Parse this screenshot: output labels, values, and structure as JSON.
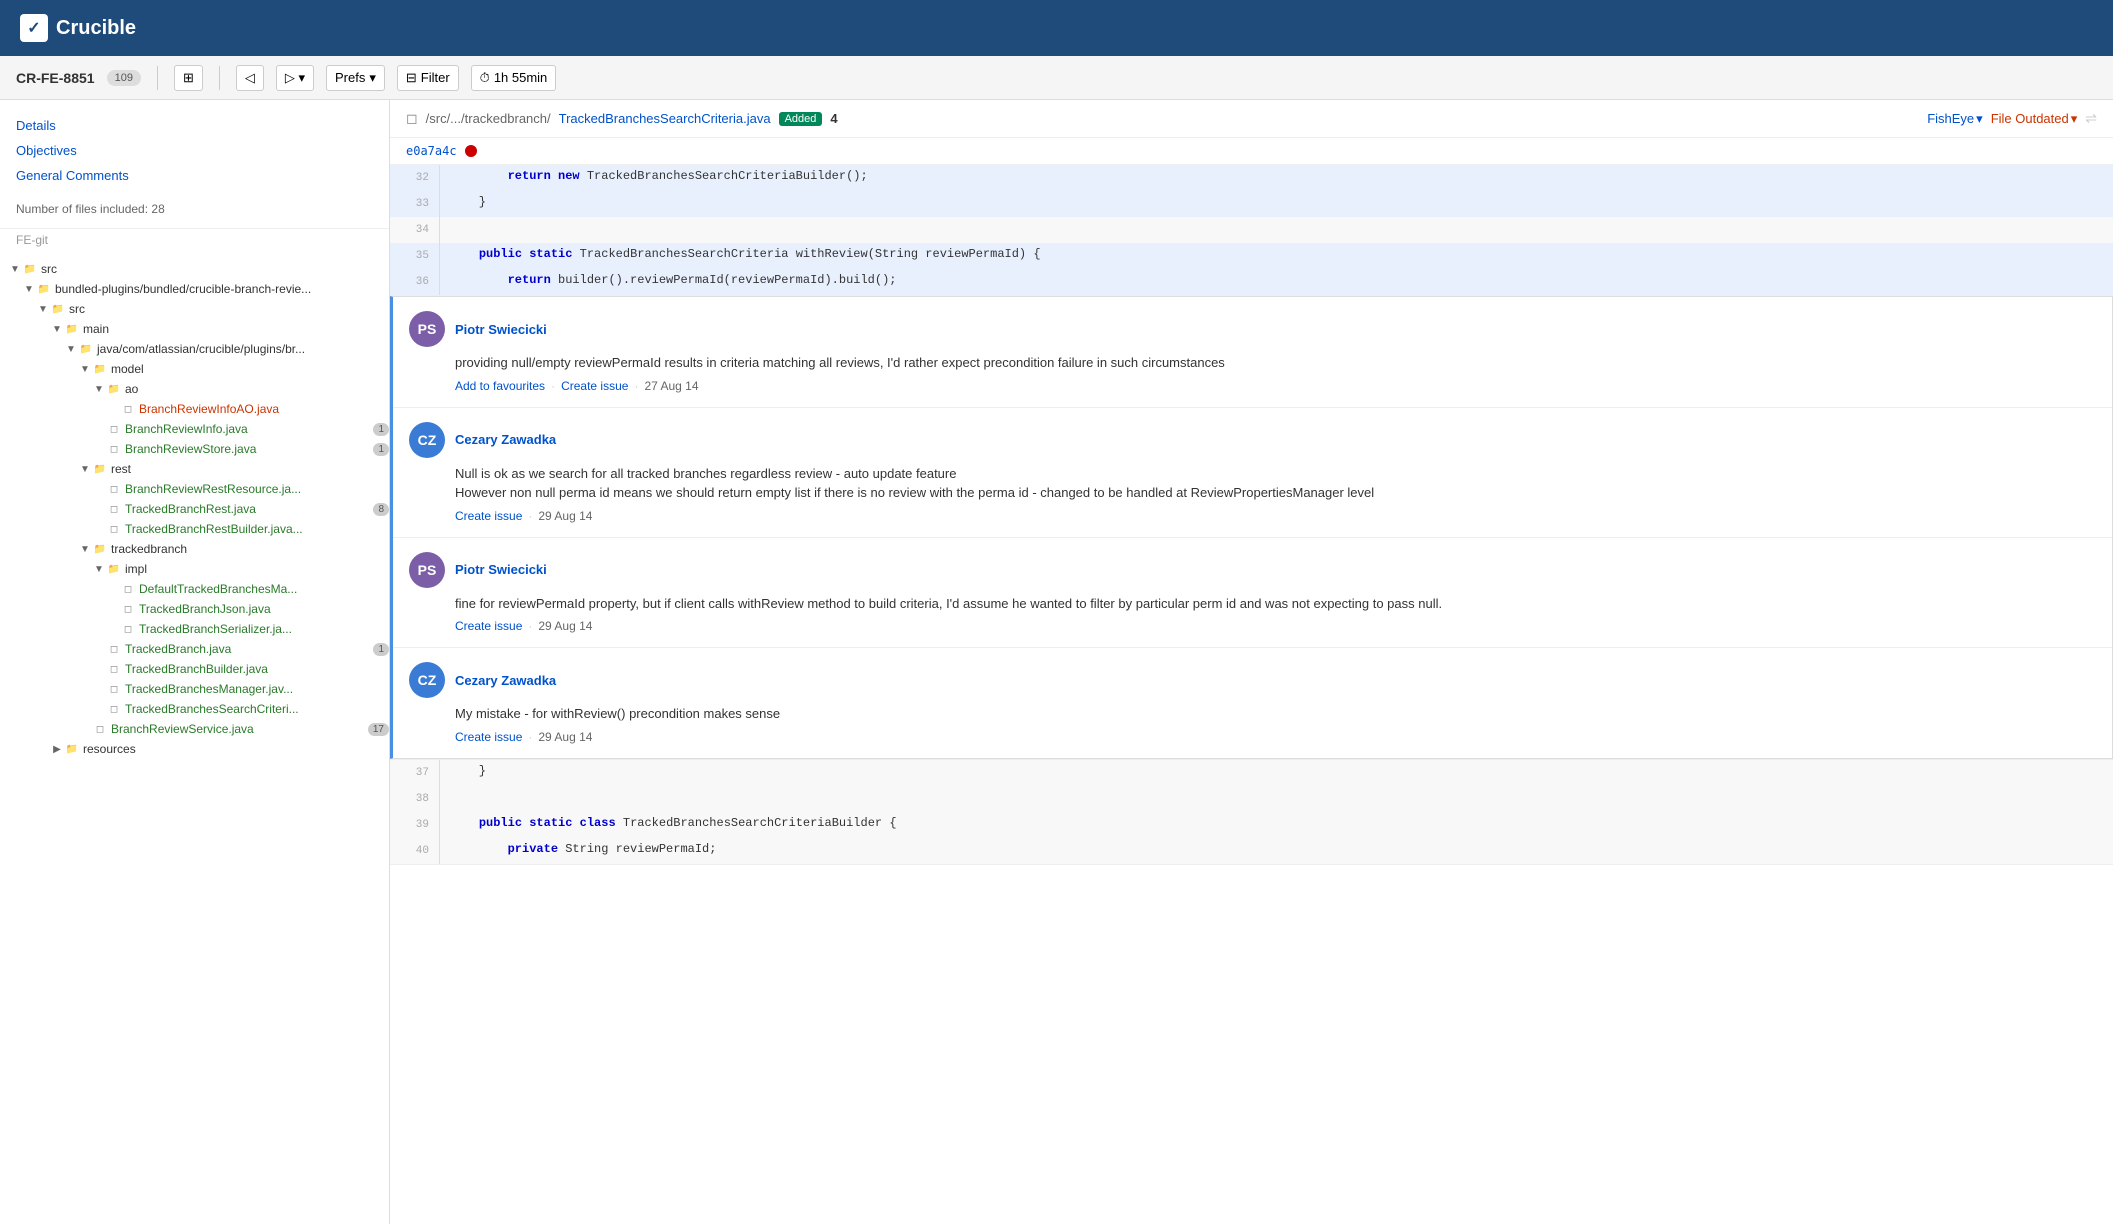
{
  "app": {
    "name": "Crucible",
    "logo_char": "✓"
  },
  "review": {
    "id": "CR-FE-8851",
    "comment_count": "109",
    "expand_icon": "⊞"
  },
  "toolbar": {
    "back_icon": "◁",
    "forward_icon": "▷",
    "dropdown_icon": "▾",
    "prefs_label": "Prefs",
    "filter_label": "Filter",
    "time_label": "1h 55min",
    "filter_icon": "⊟",
    "clock_icon": "⏱"
  },
  "sidebar": {
    "details_label": "Details",
    "objectives_label": "Objectives",
    "general_comments_label": "General Comments",
    "file_count_label": "Number of files included: 28",
    "repo_label": "FE-git"
  },
  "file_tree": {
    "items": [
      {
        "indent": 0,
        "type": "folder",
        "label": "src",
        "open": true
      },
      {
        "indent": 1,
        "type": "folder",
        "label": "bundled-plugins/bundled/crucible-branch-revie...",
        "open": true
      },
      {
        "indent": 2,
        "type": "folder",
        "label": "src",
        "open": true
      },
      {
        "indent": 3,
        "type": "folder",
        "label": "main",
        "open": true
      },
      {
        "indent": 4,
        "type": "folder",
        "label": "java/com/atlassian/crucible/plugins/br...",
        "open": true
      },
      {
        "indent": 5,
        "type": "folder",
        "label": "model",
        "open": true
      },
      {
        "indent": 6,
        "type": "folder",
        "label": "ao",
        "open": true
      },
      {
        "indent": 7,
        "type": "file",
        "label": "BranchReviewInfoAO.java",
        "color": "red"
      },
      {
        "indent": 6,
        "type": "file",
        "label": "BranchReviewInfo.java",
        "color": "green",
        "badge": "1"
      },
      {
        "indent": 6,
        "type": "file",
        "label": "BranchReviewStore.java",
        "color": "green",
        "badge": "1"
      },
      {
        "indent": 5,
        "type": "folder",
        "label": "rest",
        "open": true
      },
      {
        "indent": 6,
        "type": "file",
        "label": "BranchReviewRestResource.ja...",
        "color": "green"
      },
      {
        "indent": 6,
        "type": "file",
        "label": "TrackedBranchRest.java",
        "color": "green",
        "badge": "8"
      },
      {
        "indent": 6,
        "type": "file",
        "label": "TrackedBranchRestBuilder.java...",
        "color": "green"
      },
      {
        "indent": 5,
        "type": "folder",
        "label": "trackedbranch",
        "open": true
      },
      {
        "indent": 6,
        "type": "folder",
        "label": "impl",
        "open": true
      },
      {
        "indent": 7,
        "type": "file",
        "label": "DefaultTrackedBranchesMa...",
        "color": "green"
      },
      {
        "indent": 7,
        "type": "file",
        "label": "TrackedBranchJson.java",
        "color": "green",
        "badge": ""
      },
      {
        "indent": 7,
        "type": "file",
        "label": "TrackedBranchSerializer.ja...",
        "color": "green"
      },
      {
        "indent": 6,
        "type": "file",
        "label": "TrackedBranch.java",
        "color": "green",
        "badge": "1"
      },
      {
        "indent": 6,
        "type": "file",
        "label": "TrackedBranchBuilder.java",
        "color": "green"
      },
      {
        "indent": 6,
        "type": "file",
        "label": "TrackedBranchesManager.jav...",
        "color": "green"
      },
      {
        "indent": 6,
        "type": "file",
        "label": "TrackedBranchesSearchCriteri...",
        "color": "green"
      },
      {
        "indent": 5,
        "type": "file",
        "label": "BranchReviewService.java",
        "color": "green",
        "badge": "17"
      },
      {
        "indent": 3,
        "type": "folder",
        "label": "resources",
        "open": false
      }
    ]
  },
  "file_view": {
    "path": "/src/.../trackedbranch/",
    "filename": "TrackedBranchesSearchCriteria.java",
    "status": "Added",
    "comment_count": "4",
    "fisheye_label": "FishEye",
    "file_outdated_label": "File Outdated",
    "commit_hash": "e0a7a4c",
    "lines": [
      {
        "num": "32",
        "content": "        return new TrackedBranchesSearchCriteriaBuilder();",
        "highlight": true
      },
      {
        "num": "33",
        "content": "    }",
        "highlight": true
      },
      {
        "num": "34",
        "content": "",
        "highlight": false
      },
      {
        "num": "35",
        "content": "    public static TrackedBranchesSearchCriteria withReview(String reviewPermaId) {",
        "highlight": true
      },
      {
        "num": "36",
        "content": "        return builder().reviewPermaId(reviewPermaId).build();",
        "highlight": true
      }
    ],
    "lines_bottom": [
      {
        "num": "37",
        "content": "    }",
        "highlight": false
      },
      {
        "num": "38",
        "content": "",
        "highlight": false
      },
      {
        "num": "39",
        "content": "    public static class TrackedBranchesSearchCriteriaBuilder {",
        "highlight": false
      },
      {
        "num": "40",
        "content": "        private String reviewPermaId;",
        "highlight": false
      }
    ]
  },
  "comments": [
    {
      "id": "c1",
      "author": "Piotr Swiecicki",
      "avatar_initials": "PS",
      "avatar_class": "avatar-ps",
      "body": "providing null/empty reviewPermaId results in criteria matching all reviews, I'd rather expect precondition failure in such circumstances",
      "actions": [
        "Add to favourites",
        "Create issue"
      ],
      "date": "27 Aug 14"
    },
    {
      "id": "c2",
      "author": "Cezary Zawadka",
      "avatar_initials": "CZ",
      "avatar_class": "avatar-cz",
      "body": "Null is ok as we search for all tracked branches regardless review - auto update feature\nHowever non null perma id means we should return empty list if there is no review with the perma id - changed to be handled at ReviewPropertiesManager level",
      "actions": [
        "Create issue"
      ],
      "date": "29 Aug 14"
    },
    {
      "id": "c3",
      "author": "Piotr Swiecicki",
      "avatar_initials": "PS",
      "avatar_class": "avatar-ps",
      "body": "fine for reviewPermaId property, but if client calls withReview method to build criteria, I'd assume he wanted to filter by particular perm id and was not expecting to pass null.",
      "actions": [
        "Create issue"
      ],
      "date": "29 Aug 14"
    },
    {
      "id": "c4",
      "author": "Cezary Zawadka",
      "avatar_initials": "CZ",
      "avatar_class": "avatar-cz",
      "body": "My mistake - for withReview() precondition makes sense",
      "actions": [
        "Create issue"
      ],
      "date": "29 Aug 14"
    }
  ]
}
